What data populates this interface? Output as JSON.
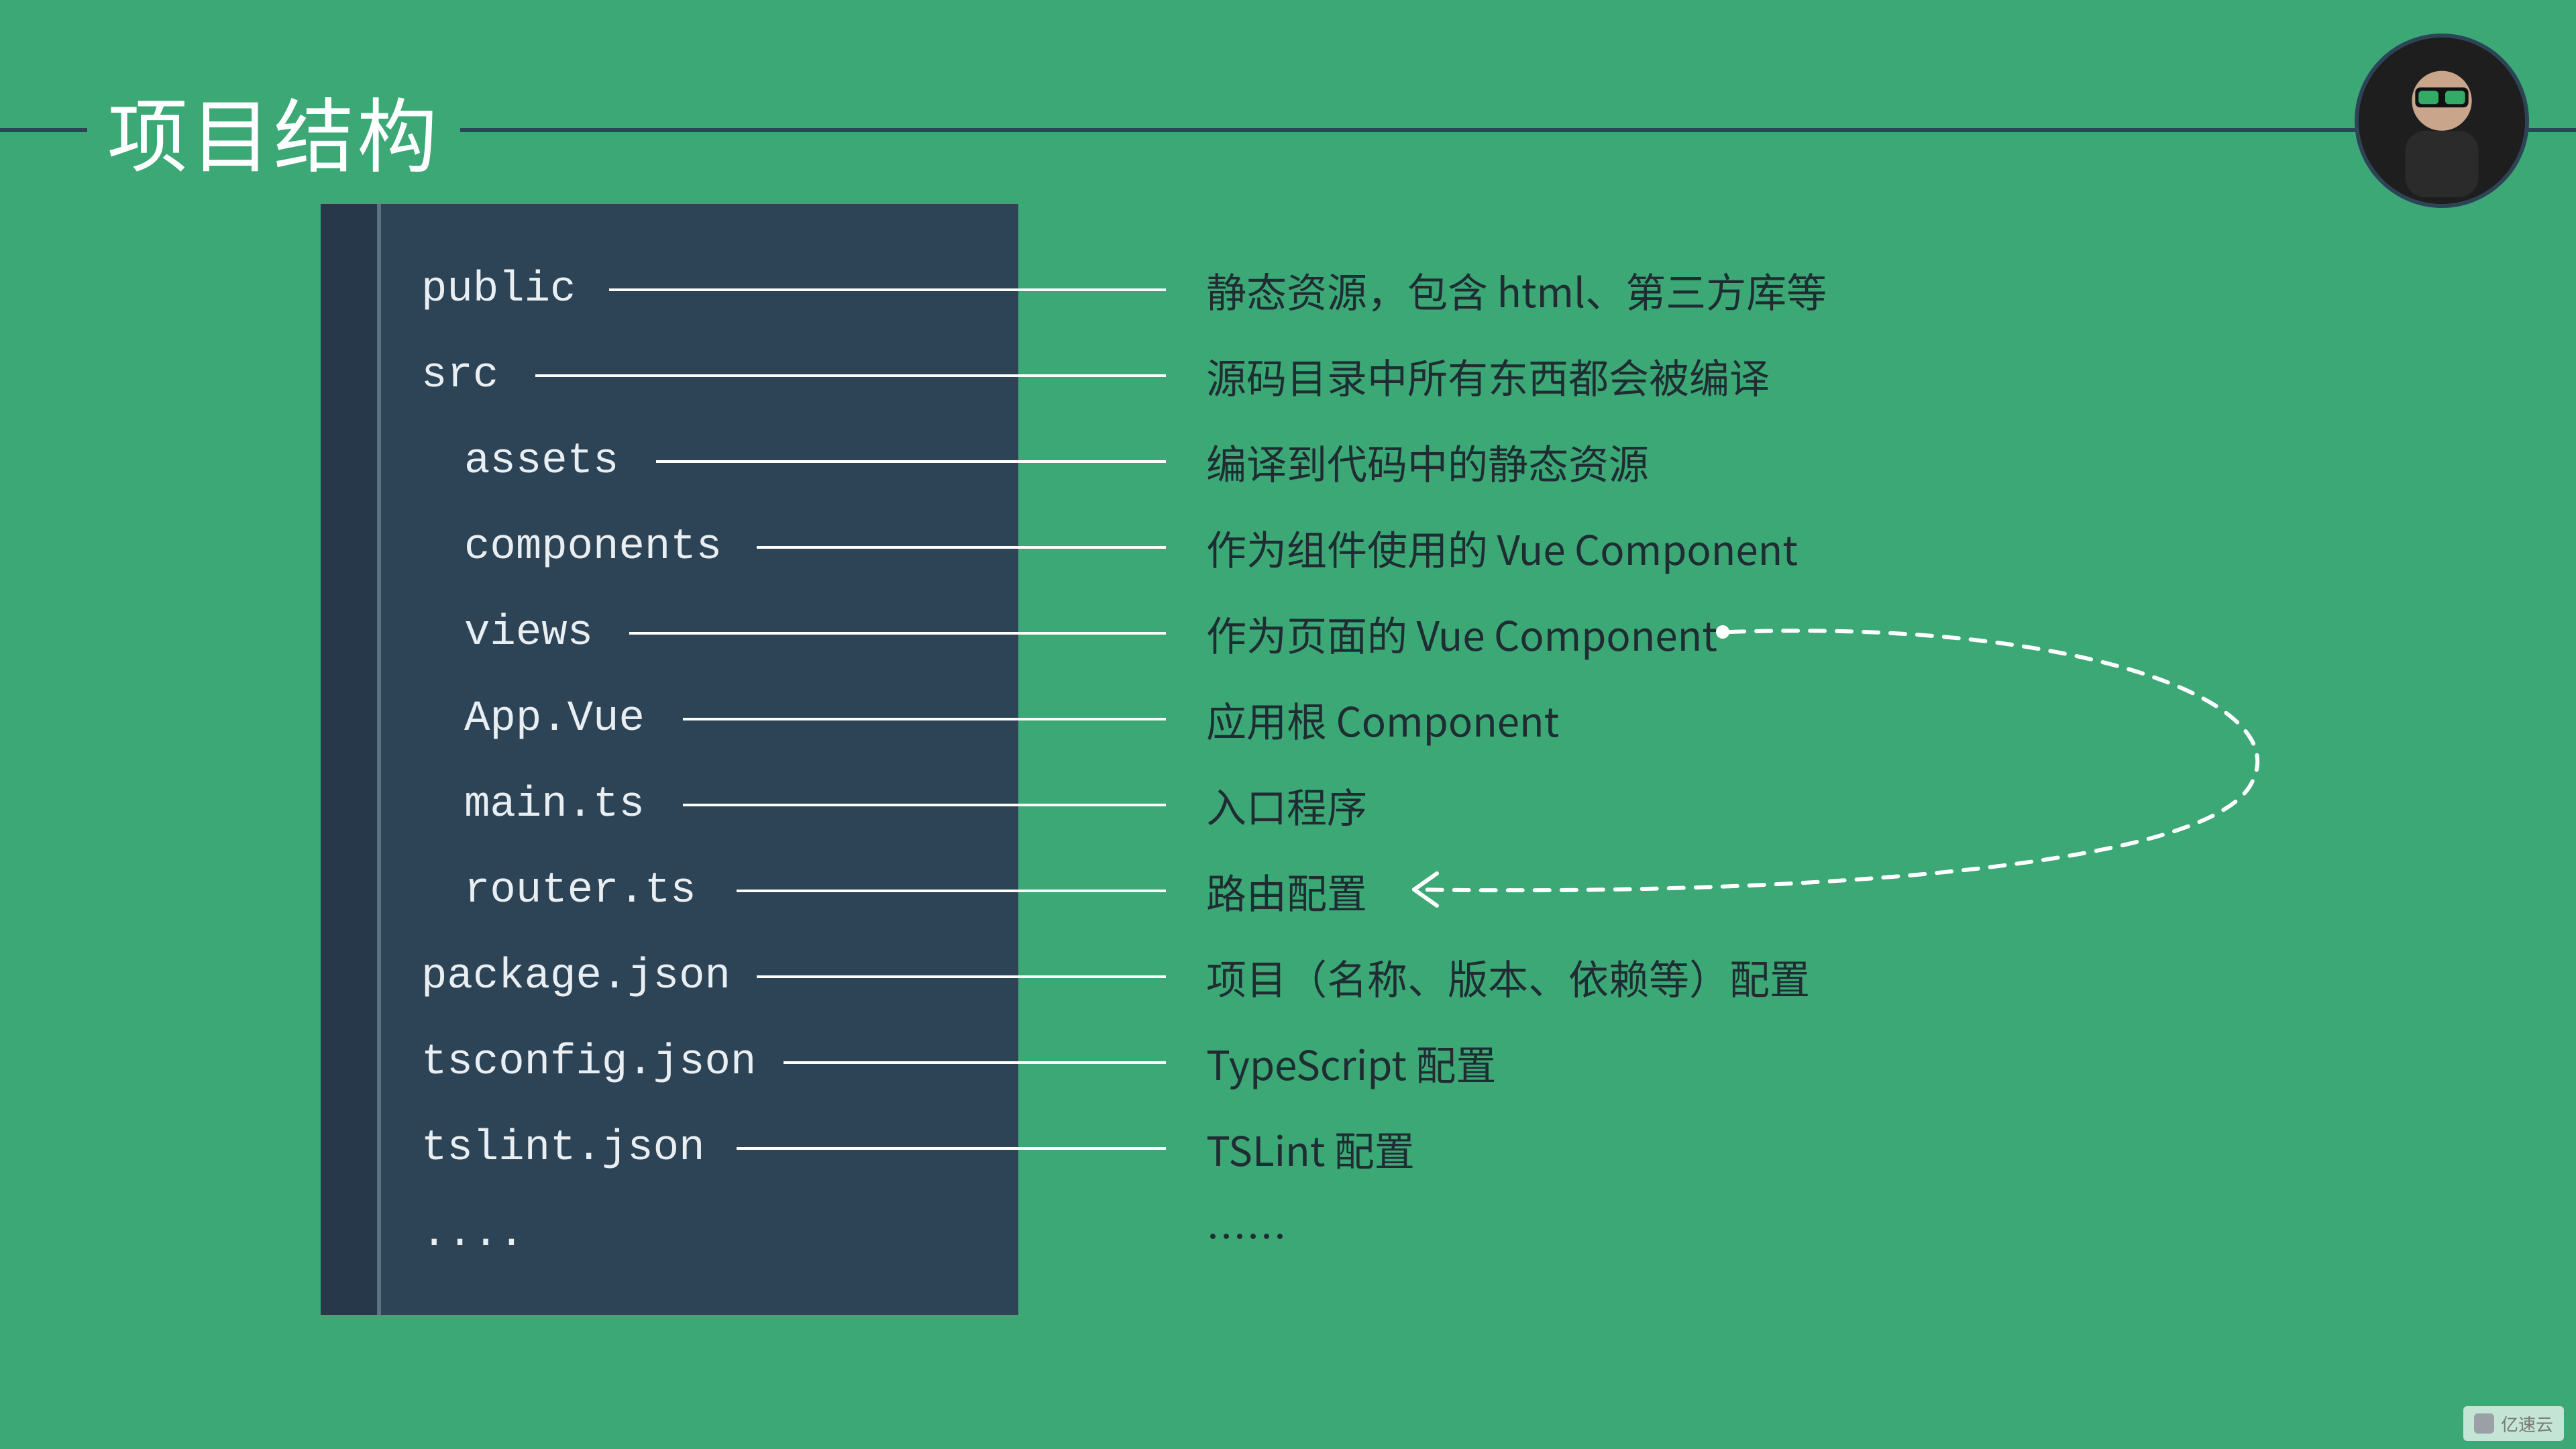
{
  "slide": {
    "title": "项目结构",
    "avatar_alt": "presenter-photo"
  },
  "structure": [
    {
      "name": "public",
      "indent": 0,
      "desc": "静态资源，包含 html、第三方库等"
    },
    {
      "name": "src",
      "indent": 0,
      "desc": "源码目录中所有东西都会被编译"
    },
    {
      "name": "assets",
      "indent": 1,
      "desc": "编译到代码中的静态资源"
    },
    {
      "name": "components",
      "indent": 1,
      "desc": "作为组件使用的 Vue Component"
    },
    {
      "name": "views",
      "indent": 1,
      "desc": "作为页面的 Vue Component"
    },
    {
      "name": "App.Vue",
      "indent": 1,
      "desc": "应用根 Component"
    },
    {
      "name": "main.ts",
      "indent": 1,
      "desc": "入口程序"
    },
    {
      "name": "router.ts",
      "indent": 1,
      "desc": "路由配置"
    },
    {
      "name": "package.json",
      "indent": 0,
      "desc": "项目（名称、版本、依赖等）配置"
    },
    {
      "name": "tsconfig.json",
      "indent": 0,
      "desc": "TypeScript 配置"
    },
    {
      "name": "tslint.json",
      "indent": 0,
      "desc": "TSLint 配置"
    },
    {
      "name": "....",
      "indent": 0,
      "desc": "……"
    }
  ],
  "arrow": {
    "from_row": 4,
    "to_row": 7,
    "note": "dashed arrow from 'views' description looping down to 'router.ts' description"
  },
  "watermark": {
    "text": "亿速云"
  },
  "colors": {
    "bg": "#3ba876",
    "panel": "#2d4456",
    "panel_gutter": "#26384a",
    "gutter_edge": "#5a7186",
    "file_text": "#e9eef2",
    "desc_text": "#1f2d33",
    "rule": "#2d4456",
    "connector": "#ffffff",
    "dash": "#ffffff"
  }
}
